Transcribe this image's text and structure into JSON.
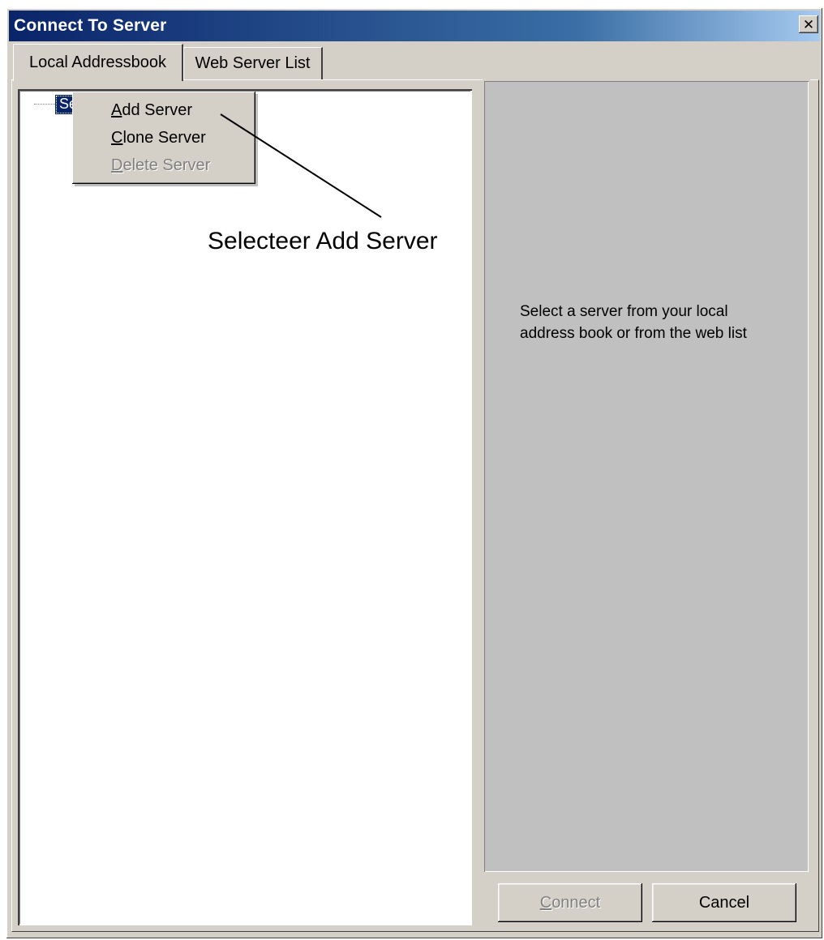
{
  "window": {
    "title": "Connect To Server",
    "close_glyph": "✕"
  },
  "tabs": [
    {
      "label": "Local Addressbook",
      "active": true
    },
    {
      "label": "Web Server List",
      "active": false
    }
  ],
  "tree": {
    "root_label": "Servers",
    "selected": true
  },
  "context_menu": {
    "items": [
      {
        "label": "Add Server",
        "mnemonic": "A",
        "rest": "dd Server",
        "enabled": true
      },
      {
        "label": "Clone Server",
        "mnemonic": "C",
        "rest": "lone Server",
        "enabled": true
      },
      {
        "label": "Delete Server",
        "mnemonic": "D",
        "rest": "elete Server",
        "enabled": false
      }
    ]
  },
  "annotation": {
    "text": "Selecteer Add Server"
  },
  "info_panel": {
    "line1": "Select a server from your local",
    "line2": "address book or from the web list"
  },
  "buttons": {
    "connect": {
      "mnemonic": "C",
      "rest": "onnect",
      "enabled": false
    },
    "cancel": {
      "label": "Cancel",
      "enabled": true
    }
  },
  "colors": {
    "titlebar_start": "#0a246a",
    "titlebar_end": "#a6caf0",
    "face": "#d4d0c8",
    "selection": "#0a246a",
    "disabled_text": "#808080"
  },
  "icons": [
    "close-icon"
  ]
}
